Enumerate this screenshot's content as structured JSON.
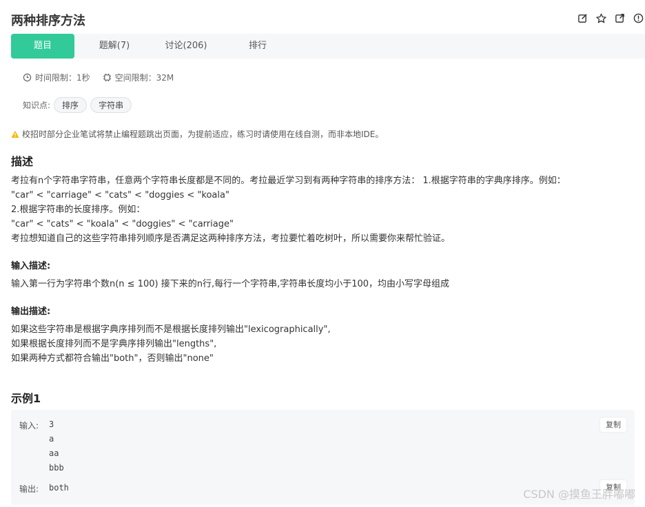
{
  "header": {
    "title": "两种排序方法",
    "icons": [
      "edit-icon",
      "star-icon",
      "external-link-icon",
      "info-icon"
    ]
  },
  "tabs": [
    {
      "label": "题目",
      "active": true
    },
    {
      "label": "题解(7)",
      "active": false
    },
    {
      "label": "讨论(206)",
      "active": false
    },
    {
      "label": "排行",
      "active": false
    }
  ],
  "meta": {
    "time_limit": "时间限制：1秒",
    "space_limit": "空间限制：32M",
    "knowledge_label": "知识点:",
    "tags": [
      "排序",
      "字符串"
    ]
  },
  "notice": "校招时部分企业笔试将禁止编程题跳出页面，为提前适应，练习时请使用在线自测，而非本地IDE。",
  "description": {
    "heading": "描述",
    "lines": [
      "考拉有n个字符串字符串，任意两个字符串长度都是不同的。考拉最近学习到有两种字符串的排序方法： 1.根据字符串的字典序排序。例如：",
      "\"car\" < \"carriage\" < \"cats\" < \"doggies < \"koala\"",
      "2.根据字符串的长度排序。例如：",
      "\"car\" < \"cats\" < \"koala\" < \"doggies\" < \"carriage\"",
      "考拉想知道自己的这些字符串排列顺序是否满足这两种排序方法，考拉要忙着吃树叶，所以需要你来帮忙验证。"
    ]
  },
  "input_desc": {
    "heading": "输入描述:",
    "text": "输入第一行为字符串个数n(n ≤ 100) 接下来的n行,每行一个字符串,字符串长度均小于100，均由小写字母组成"
  },
  "output_desc": {
    "heading": "输出描述:",
    "lines": [
      "如果这些字符串是根据字典序排列而不是根据长度排列输出\"lexicographically\",",
      "如果根据长度排列而不是字典序排列输出\"lengths\",",
      "如果两种方式都符合输出\"both\"，否则输出\"none\""
    ]
  },
  "example": {
    "heading": "示例1",
    "input_label": "输入:",
    "input_lines": "3\na\naa\nbbb",
    "output_label": "输出:",
    "output": "both",
    "copy_label": "复制"
  },
  "watermark": "CSDN @摸鱼王胖嘟嘟",
  "colors": {
    "accent": "#32ca99",
    "warning": "#f5b800"
  }
}
